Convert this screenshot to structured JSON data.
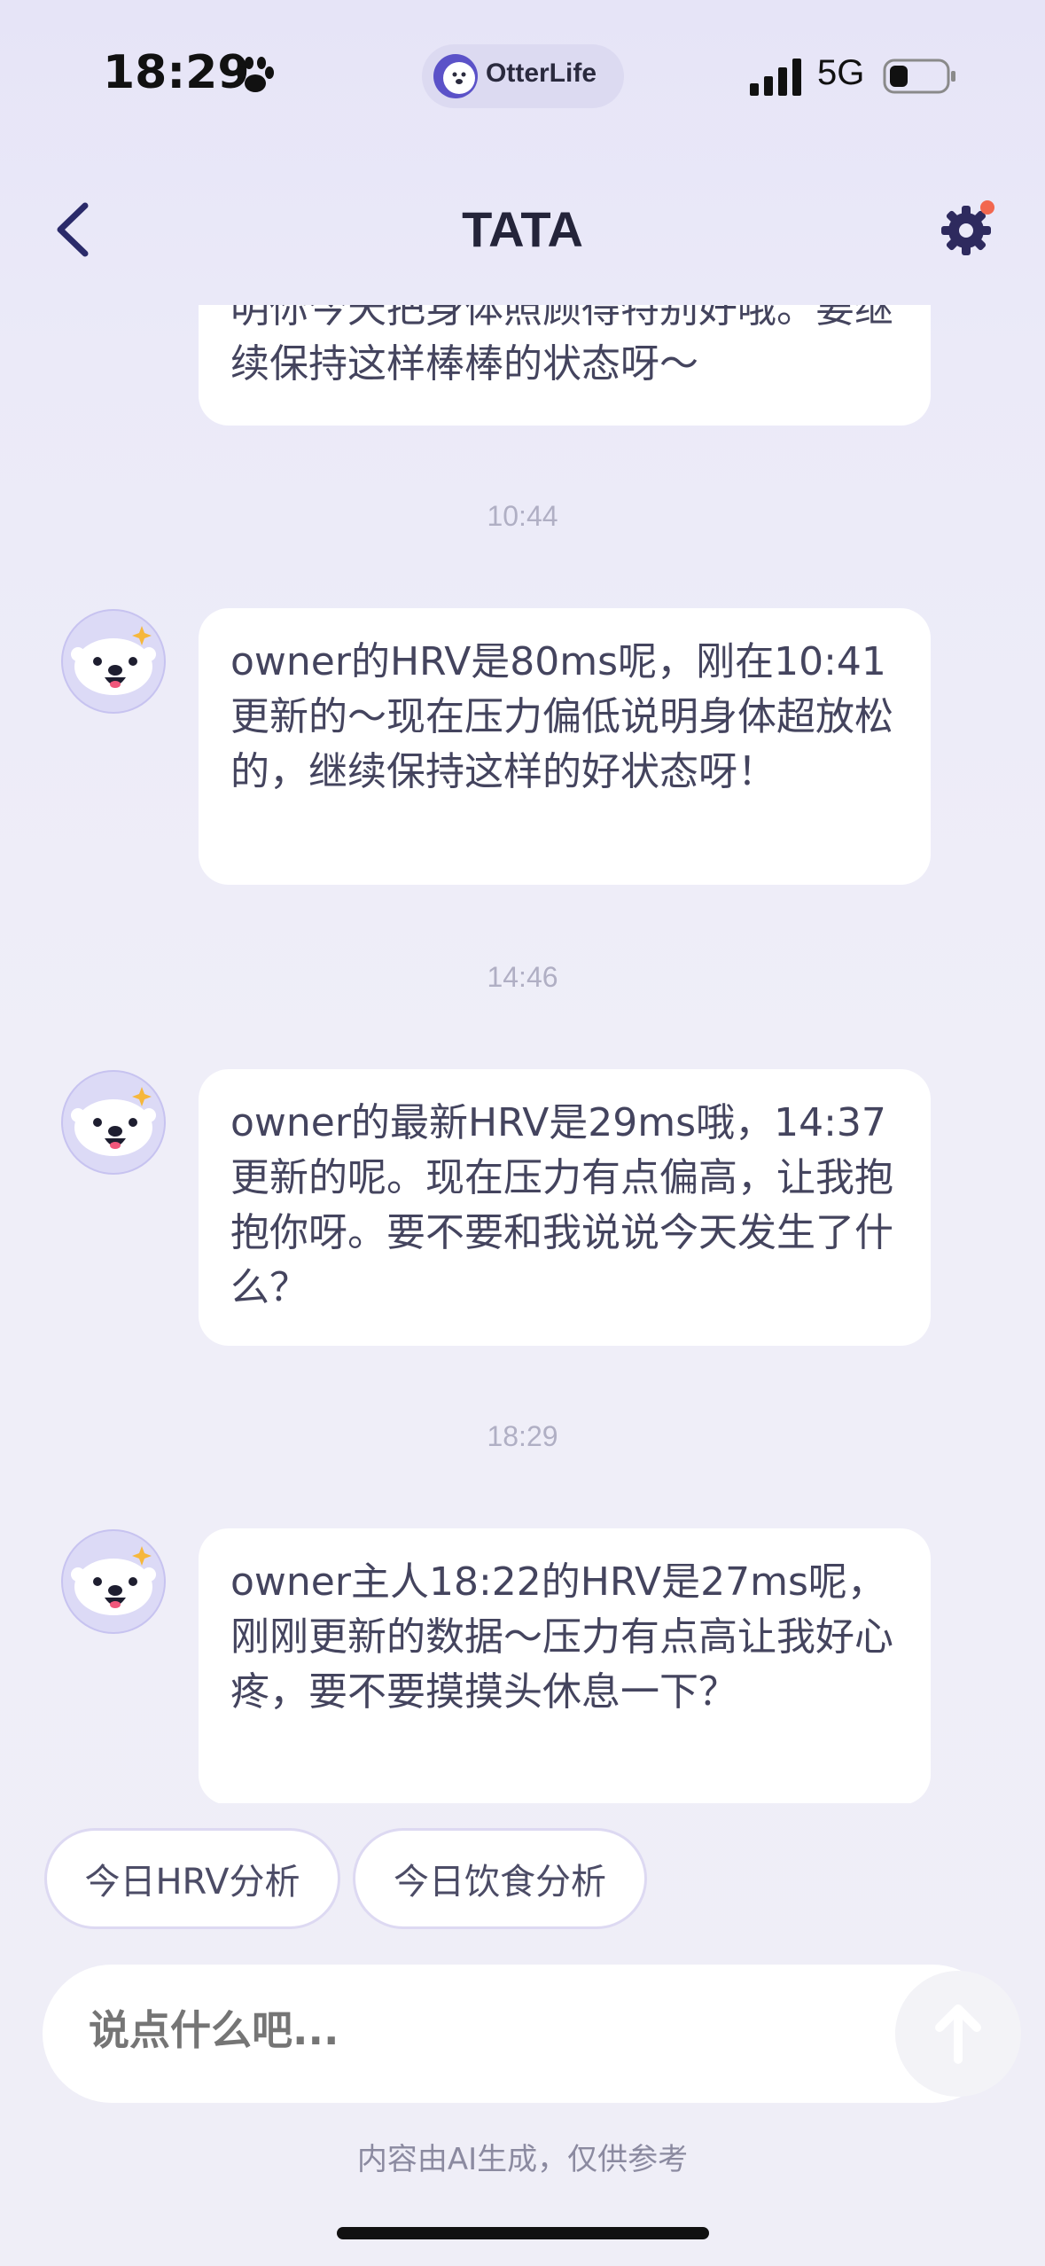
{
  "status_bar": {
    "time": "18:29",
    "network": "5G",
    "icons": [
      "paw-icon",
      "signal-icon",
      "battery-icon"
    ]
  },
  "brand": {
    "name": "OtterLife",
    "icon": "otter-logo-icon"
  },
  "header": {
    "title": "TATA",
    "back_icon": "chevron-left-icon",
    "settings_icon": "gear-icon",
    "notification_dot_color": "#f2674f"
  },
  "messages": [
    {
      "text": "明你今天把身体照顾得特别好哦。要继续保持这样棒棒的状态呀～"
    },
    {
      "time": "10:44",
      "text": "owner的HRV是80ms呢，刚在10:41更新的～现在压力偏低说明身体超放松的，继续保持这样的好状态呀！"
    },
    {
      "time": "14:46",
      "text": "owner的最新HRV是29ms哦，14:37更新的呢。现在压力有点偏高，让我抱抱你呀。要不要和我说说今天发生了什么？"
    },
    {
      "time": "18:29",
      "text": "owner主人18:22的HRV是27ms呢，刚刚更新的数据～压力有点高让我好心疼，要不要摸摸头休息一下？"
    }
  ],
  "suggestions": [
    "今日HRV分析",
    "今日饮食分析"
  ],
  "input": {
    "placeholder": "说点什么吧...",
    "send_icon": "arrow-up-icon"
  },
  "disclaimer": "内容由AI生成，仅供参考",
  "colors": {
    "accent": "#2e2a6e",
    "background": "#ebeaf8",
    "bubble": "#ffffff"
  }
}
